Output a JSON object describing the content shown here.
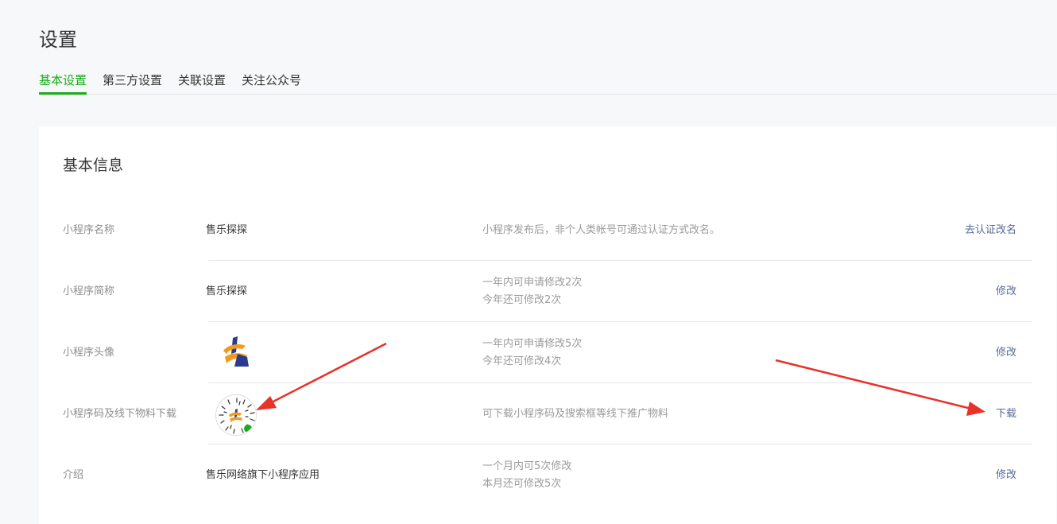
{
  "page": {
    "title": "设置"
  },
  "tabs": [
    {
      "label": "基本设置",
      "active": true
    },
    {
      "label": "第三方设置",
      "active": false
    },
    {
      "label": "关联设置",
      "active": false
    },
    {
      "label": "关注公众号",
      "active": false
    }
  ],
  "card": {
    "title": "基本信息",
    "rows": [
      {
        "label": "小程序名称",
        "value": "售乐探探",
        "desc": [
          "小程序发布后，非个人类帐号可通过认证方式改名。"
        ],
        "action": "去认证改名"
      },
      {
        "label": "小程序简称",
        "value": "售乐探探",
        "desc": [
          "一年内可申请修改2次",
          "今年还可修改2次"
        ],
        "action": "修改"
      },
      {
        "label": "小程序头像",
        "value": "",
        "desc": [
          "一年内可申请修改5次",
          "今年还可修改4次"
        ],
        "action": "修改"
      },
      {
        "label": "小程序码及线下物料下载",
        "value": "",
        "desc": [
          "可下载小程序码及搜索框等线下推广物料"
        ],
        "action": "下载"
      },
      {
        "label": "介绍",
        "value": "售乐网络旗下小程序应用",
        "desc": [
          "一个月内可5次修改",
          "本月还可修改5次"
        ],
        "action": "修改"
      }
    ]
  },
  "colors": {
    "accent": "#1aad19",
    "link": "#576b95",
    "annotation_arrow": "#e8322a"
  },
  "icons": {
    "avatar": "app-logo-icon",
    "qr": "miniprogram-code-icon"
  }
}
